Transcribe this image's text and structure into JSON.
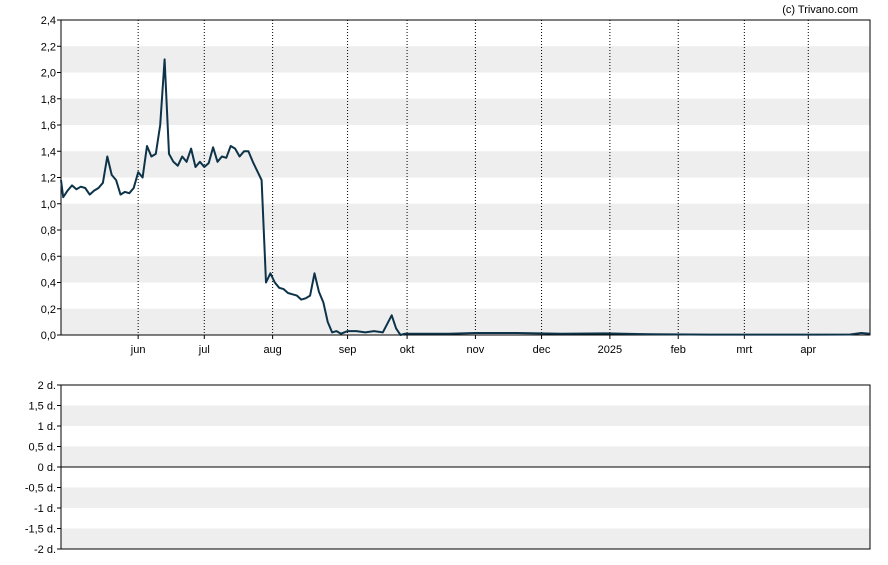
{
  "credit": "(c) Trivano.com",
  "colors": {
    "line": "#0d3349",
    "band": "#eeeeee",
    "frame": "#000000",
    "vgrid": "#000000",
    "zero_line": "#000000"
  },
  "chart_data": [
    {
      "type": "line",
      "title": "",
      "xlabel": "",
      "ylabel": "",
      "ylim": [
        0,
        2.4
      ],
      "yticks": [
        "0,0",
        "0,2",
        "0,4",
        "0,6",
        "0,8",
        "1,0",
        "1,2",
        "1,4",
        "1,6",
        "1,8",
        "2,0",
        "2,2",
        "2,4"
      ],
      "xlim": [
        "2024-04-27",
        "2025-04-29"
      ],
      "xticks": [
        {
          "date": "2024-06-01",
          "label": "jun"
        },
        {
          "date": "2024-07-01",
          "label": "jul"
        },
        {
          "date": "2024-08-01",
          "label": "aug"
        },
        {
          "date": "2024-09-04",
          "label": "sep"
        },
        {
          "date": "2024-10-01",
          "label": "okt"
        },
        {
          "date": "2024-11-01",
          "label": "nov"
        },
        {
          "date": "2024-12-01",
          "label": "dec"
        },
        {
          "date": "2025-01-01",
          "label": "2025"
        },
        {
          "date": "2025-02-01",
          "label": "feb"
        },
        {
          "date": "2025-03-03",
          "label": "mrt"
        },
        {
          "date": "2025-04-01",
          "label": "apr"
        }
      ],
      "grid": "alternating horizontal bands, dotted vertical lines at month ticks",
      "series": [
        {
          "x": [
            "2024-04-27",
            "2024-04-28",
            "2024-04-30",
            "2024-05-02",
            "2024-05-04",
            "2024-05-06",
            "2024-05-08",
            "2024-05-10",
            "2024-05-12",
            "2024-05-14",
            "2024-05-16",
            "2024-05-18",
            "2024-05-20",
            "2024-05-22",
            "2024-05-24",
            "2024-05-26",
            "2024-05-28",
            "2024-05-30",
            "2024-06-01",
            "2024-06-03",
            "2024-06-05",
            "2024-06-07",
            "2024-06-09",
            "2024-06-11",
            "2024-06-13",
            "2024-06-15",
            "2024-06-17",
            "2024-06-19",
            "2024-06-21",
            "2024-06-23",
            "2024-06-25",
            "2024-06-27",
            "2024-06-29",
            "2024-07-01",
            "2024-07-03",
            "2024-07-05",
            "2024-07-07",
            "2024-07-09",
            "2024-07-11",
            "2024-07-13",
            "2024-07-15",
            "2024-07-17",
            "2024-07-19",
            "2024-07-21",
            "2024-07-23",
            "2024-07-25",
            "2024-07-27",
            "2024-07-29",
            "2024-07-31",
            "2024-08-02",
            "2024-08-04",
            "2024-08-06",
            "2024-08-08",
            "2024-08-10",
            "2024-08-12",
            "2024-08-14",
            "2024-08-16",
            "2024-08-18",
            "2024-08-20",
            "2024-08-22",
            "2024-08-24",
            "2024-08-26",
            "2024-08-28",
            "2024-08-30",
            "2024-09-01",
            "2024-09-04",
            "2024-09-08",
            "2024-09-12",
            "2024-09-16",
            "2024-09-20",
            "2024-09-24",
            "2024-09-26",
            "2024-09-28",
            "2024-09-30",
            "2024-10-02",
            "2024-10-10",
            "2024-10-20",
            "2024-11-01",
            "2024-11-20",
            "2024-12-10",
            "2024-12-30",
            "2025-01-20",
            "2025-02-15",
            "2025-03-10",
            "2025-04-05",
            "2025-04-20",
            "2025-04-25",
            "2025-04-29"
          ],
          "values": [
            1.18,
            1.05,
            1.1,
            1.14,
            1.11,
            1.13,
            1.12,
            1.07,
            1.1,
            1.12,
            1.16,
            1.36,
            1.22,
            1.18,
            1.07,
            1.09,
            1.08,
            1.12,
            1.24,
            1.2,
            1.44,
            1.36,
            1.38,
            1.6,
            2.1,
            1.38,
            1.32,
            1.29,
            1.36,
            1.32,
            1.42,
            1.28,
            1.32,
            1.28,
            1.31,
            1.43,
            1.32,
            1.36,
            1.35,
            1.44,
            1.42,
            1.36,
            1.4,
            1.4,
            1.32,
            1.25,
            1.18,
            0.4,
            0.47,
            0.4,
            0.36,
            0.35,
            0.32,
            0.31,
            0.3,
            0.27,
            0.28,
            0.3,
            0.47,
            0.33,
            0.25,
            0.1,
            0.02,
            0.03,
            0.01,
            0.03,
            0.03,
            0.02,
            0.03,
            0.02,
            0.15,
            0.05,
            0.0,
            0.01,
            0.01,
            0.01,
            0.01,
            0.015,
            0.015,
            0.01,
            0.012,
            0.005,
            0.003,
            0.003,
            0.003,
            0.004,
            0.015,
            0.01
          ]
        }
      ]
    },
    {
      "type": "line",
      "title": "",
      "ylim": [
        -2,
        2
      ],
      "yticks": [
        "2 d.",
        "1,5 d.",
        "1 d.",
        "0,5 d.",
        "0 d.",
        "-0,5 d.",
        "-1 d.",
        "-1,5 d.",
        "-2 d."
      ],
      "grid": "alternating horizontal bands, solid zero line",
      "series": []
    }
  ]
}
